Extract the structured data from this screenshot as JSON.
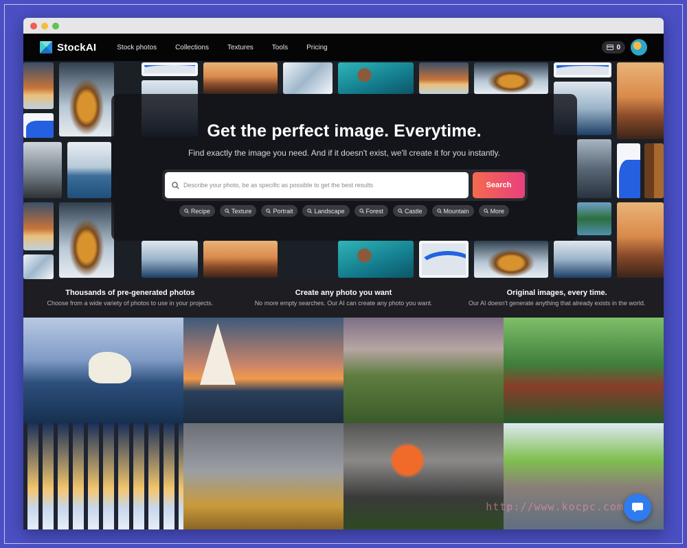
{
  "app": {
    "name": "StockAI",
    "credits": "0"
  },
  "nav": {
    "links": [
      "Stock photos",
      "Collections",
      "Textures",
      "Tools",
      "Pricing"
    ]
  },
  "hero": {
    "title": "Get the perfect image. Everytime.",
    "subtitle": "Find exactly the image you need. And if it doesn't exist, we'll create it for you instantly.",
    "search": {
      "placeholder": "Describe your photo, be as specific as possible to get the best results",
      "value": "",
      "button_label": "Search"
    },
    "chips": [
      "Recipe",
      "Texture",
      "Portrait",
      "Landscape",
      "Forest",
      "Castle",
      "Mountain",
      "More"
    ]
  },
  "features": [
    {
      "title": "Thousands of pre-generated photos",
      "desc": "Choose from a wide variety of photos to use in your projects."
    },
    {
      "title": "Create any photo you want",
      "desc": "No more empty searches. Our AI can create any photo you want."
    },
    {
      "title": "Original images, every time.",
      "desc": "Our AI doesn't generate anything that already exists in the world."
    }
  ],
  "gallery": [
    "polar-bear",
    "sailboats-sunset",
    "hill-castle",
    "jungle-river",
    "winter-forest",
    "windmill-field",
    "volcano-eruption",
    "city-canal"
  ],
  "watermark": "http://www.kocpc.com.tw",
  "icons": {
    "logo": "stockai-logo-icon",
    "credits": "credit-card-icon",
    "search": "search-icon",
    "chip": "search-icon",
    "chat": "chat-icon"
  },
  "colors": {
    "accent_start": "#f46a4e",
    "accent_end": "#e8407d",
    "background": "#4a4fc4"
  }
}
